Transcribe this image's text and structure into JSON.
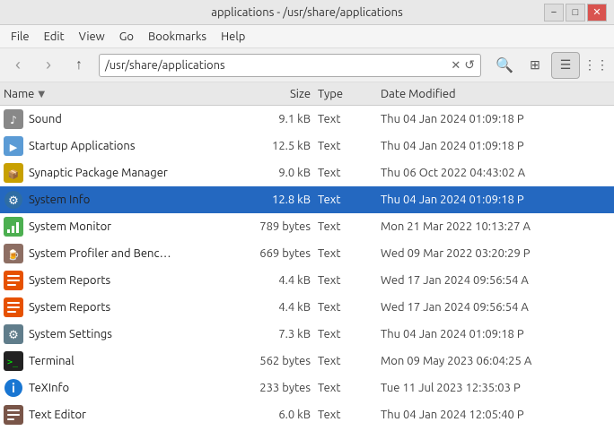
{
  "window": {
    "title": "applications - /usr/share/applications",
    "controls": [
      "−",
      "□",
      "✕"
    ]
  },
  "menu": {
    "items": [
      "File",
      "Edit",
      "View",
      "Go",
      "Bookmarks",
      "Help"
    ]
  },
  "toolbar": {
    "back_label": "‹",
    "forward_label": "›",
    "up_label": "↑",
    "address": "/usr/share/applications",
    "clear_icon": "✕",
    "reload_icon": "↺",
    "search_icon": "🔍"
  },
  "columns": {
    "name": "Name",
    "size": "Size",
    "type": "Type",
    "date": "Date Modified"
  },
  "files": [
    {
      "id": 1,
      "name": "Sound",
      "size": "9.1 kB",
      "type": "Text",
      "date": "Thu 04 Jan 2024 01:09:18 P",
      "icon": "sound",
      "selected": false
    },
    {
      "id": 2,
      "name": "Startup Applications",
      "size": "12.5 kB",
      "type": "Text",
      "date": "Thu 04 Jan 2024 01:09:18 P",
      "icon": "startup",
      "selected": false
    },
    {
      "id": 3,
      "name": "Synaptic Package Manager",
      "size": "9.0 kB",
      "type": "Text",
      "date": "Thu 06 Oct 2022 04:43:02 A",
      "icon": "synaptic",
      "selected": false
    },
    {
      "id": 4,
      "name": "System Info",
      "size": "12.8 kB",
      "type": "Text",
      "date": "Thu 04 Jan 2024 01:09:18 P",
      "icon": "sysinfo",
      "selected": true
    },
    {
      "id": 5,
      "name": "System Monitor",
      "size": "789 bytes",
      "type": "Text",
      "date": "Mon 21 Mar 2022 10:13:27 A",
      "icon": "sysmonitor",
      "selected": false
    },
    {
      "id": 6,
      "name": "System Profiler and Benc…",
      "size": "669 bytes",
      "type": "Text",
      "date": "Wed 09 Mar 2022 03:20:29 P",
      "icon": "sysprofiler",
      "selected": false
    },
    {
      "id": 7,
      "name": "System Reports",
      "size": "4.4 kB",
      "type": "Text",
      "date": "Wed 17 Jan 2024 09:56:54 A",
      "icon": "sysreports",
      "selected": false
    },
    {
      "id": 8,
      "name": "System Reports",
      "size": "4.4 kB",
      "type": "Text",
      "date": "Wed 17 Jan 2024 09:56:54 A",
      "icon": "sysreports",
      "selected": false
    },
    {
      "id": 9,
      "name": "System Settings",
      "size": "7.3 kB",
      "type": "Text",
      "date": "Thu 04 Jan 2024 01:09:18 P",
      "icon": "settings",
      "selected": false
    },
    {
      "id": 10,
      "name": "Terminal",
      "size": "562 bytes",
      "type": "Text",
      "date": "Mon 09 May 2023 06:04:25 A",
      "icon": "terminal",
      "selected": false
    },
    {
      "id": 11,
      "name": "TeXInfo",
      "size": "233 bytes",
      "type": "Text",
      "date": "Tue 11 Jul 2023 12:35:03 P",
      "icon": "texinfo",
      "selected": false
    },
    {
      "id": 12,
      "name": "Text Editor",
      "size": "6.0 kB",
      "type": "Text",
      "date": "Thu 04 Jan 2024 12:05:40 P",
      "icon": "texteditor",
      "selected": false
    }
  ],
  "icons": {
    "sound": "🔊",
    "startup": "🚀",
    "synaptic": "📦",
    "sysinfo": "ℹ",
    "sysmonitor": "📊",
    "sysprofiler": "🍺",
    "sysreports": "📋",
    "settings": "⚙",
    "terminal": "▶",
    "texinfo": "ℹ",
    "texteditor": "📝"
  }
}
